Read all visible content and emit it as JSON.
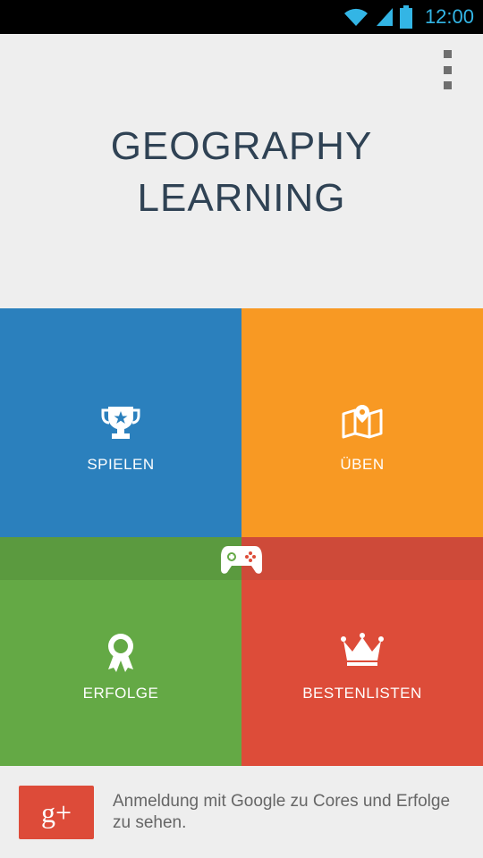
{
  "status_bar": {
    "time": "12:00",
    "icons": [
      "wifi-icon",
      "cell-signal-icon",
      "battery-icon"
    ],
    "accent_color": "#33b5e5"
  },
  "app": {
    "title_line_1": "GEOGRAPHY",
    "title_line_2": "LEARNING",
    "title_color": "#2f4254",
    "menu_icon": "overflow-menu-icon"
  },
  "tiles": [
    {
      "label": "SPIELEN",
      "icon": "trophy-icon",
      "color": "#2b80bd"
    },
    {
      "label": "ÜBEN",
      "icon": "map-icon",
      "color": "#f89923"
    },
    {
      "label": "ERFOLGE",
      "icon": "badge-icon",
      "color": "#64a945"
    },
    {
      "label": "BESTENLISTEN",
      "icon": "crown-icon",
      "color": "#dd4c39"
    }
  ],
  "games_icon": "gamepad-icon",
  "signin": {
    "button_label": "g+",
    "button_color": "#dd4b39",
    "text": "Anmeldung mit Google zu Cores und Erfolge zu sehen."
  }
}
